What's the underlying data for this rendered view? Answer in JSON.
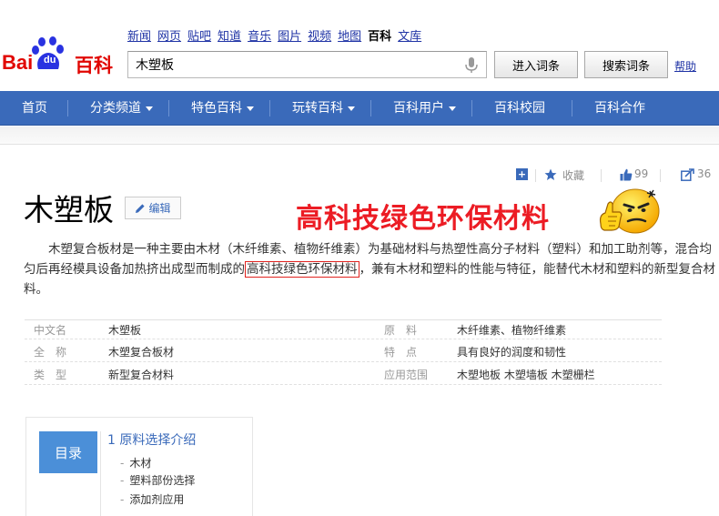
{
  "logo": {
    "bai": "Bai",
    "du": "du",
    "baike": "百科"
  },
  "topnav": [
    "新闻",
    "网页",
    "贴吧",
    "知道",
    "音乐",
    "图片",
    "视频",
    "地图",
    "百科",
    "文库"
  ],
  "topnav_current": "百科",
  "search": {
    "value": "木塑板",
    "enter_label": "进入词条",
    "search_label": "搜索词条",
    "help_label": "帮助"
  },
  "navbar": {
    "items": [
      "首页",
      "分类频道",
      "特色百科",
      "玩转百科",
      "百科用户",
      "百科校园",
      "百科合作"
    ]
  },
  "tools": {
    "favorite": "收藏",
    "likes": "99",
    "shares": "36"
  },
  "entry": {
    "title": "木塑板",
    "edit_label": "编辑",
    "summary_before": "木塑复合板材是一种主要由木材（木纤维素、植物纤维素）为基础材料与热塑性高分子材料（塑料）和加工助剂等，混合均匀后再经模具设备加热挤出成型而制成的",
    "summary_highlight": "高科技绿色环保材料",
    "summary_after": "，兼有木材和塑料的性能与特征，能替代木材和塑料的新型复合材料。"
  },
  "banner": "高科技绿色环保材料",
  "info": [
    {
      "k1": "中文名",
      "v1": "木塑板",
      "k2": "原　料",
      "v2": "木纤维素、植物纤维素"
    },
    {
      "k1": "全　称",
      "v1": "木塑复合板材",
      "k2": "特　点",
      "v2": "具有良好的润度和韧性"
    },
    {
      "k1": "类　型",
      "v1": "新型复合材料",
      "k2": "应用范围",
      "v2": "木塑地板 木塑墙板 木塑栅栏"
    }
  ],
  "toc": {
    "label": "目录",
    "heading": "1 原料选择介绍",
    "items": [
      "木材",
      "塑料部份选择",
      "添加剂应用"
    ]
  },
  "colors": {
    "brand_red": "#e10601",
    "nav_blue": "#3a6aba",
    "banner_red": "#ec1c24",
    "link_blue": "#1f33a5"
  }
}
